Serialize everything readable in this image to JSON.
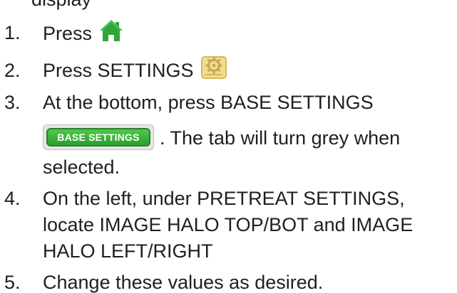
{
  "partial_top_line": "display",
  "steps": [
    {
      "number": "1.",
      "text_before": "Press",
      "icon": "home-icon"
    },
    {
      "number": "2.",
      "text_before": "Press SETTINGS",
      "icon": "settings-gear-icon"
    },
    {
      "number": "3.",
      "text_before": "At the bottom, press BASE SETTINGS",
      "button_label": "BASE SETTINGS",
      "text_after_button": ". The tab will turn grey when",
      "continuation": "selected."
    },
    {
      "number": "4.",
      "lines": [
        "On the left, under PRETREAT SETTINGS,",
        "locate IMAGE HALO TOP/BOT and IMAGE",
        "HALO LEFT/RIGHT"
      ]
    },
    {
      "number": "5.",
      "text_before": "Change these values as desired."
    }
  ],
  "colors": {
    "home_icon": "#2fa53a",
    "settings_icon_bg": "#f1dc91",
    "settings_icon_gear": "#c9a94a",
    "button_green": "#2b9f2d"
  }
}
